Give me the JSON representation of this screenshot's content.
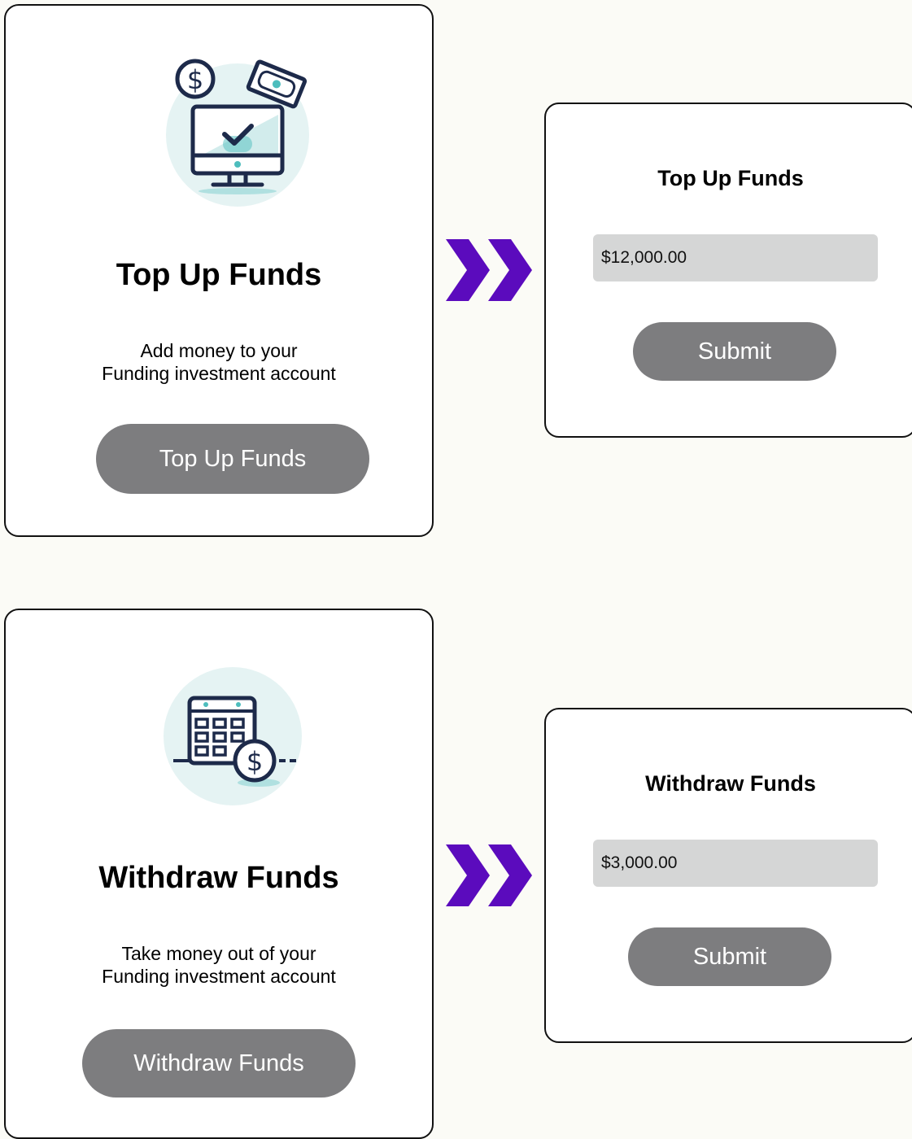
{
  "colors": {
    "page_background": "#fbfbf6",
    "card_background": "#ffffff",
    "button_gray": "#7d7d7f",
    "input_gray": "#d5d6d6",
    "chevron_purple": "#5b0bbd",
    "icon_navy": "#1d2a4a",
    "icon_teal": "#4dbdbd",
    "icon_bg": "#e5f3f3"
  },
  "top_up": {
    "card": {
      "icon": "computer-payment-icon",
      "title": "Top Up Funds",
      "description_line1": "Add money to your",
      "description_line2": "Funding investment account",
      "button_label": "Top Up Funds"
    },
    "arrow_icon": "double-chevron-right-icon",
    "form": {
      "title": "Top Up Funds",
      "amount_value": "$12,000.00",
      "submit_label": "Submit"
    }
  },
  "withdraw": {
    "card": {
      "icon": "calendar-dollar-icon",
      "title": "Withdraw Funds",
      "description_line1": "Take money out of your",
      "description_line2": "Funding investment account",
      "button_label": "Withdraw Funds"
    },
    "arrow_icon": "double-chevron-right-icon",
    "form": {
      "title": "Withdraw Funds",
      "amount_value": "$3,000.00",
      "submit_label": "Submit"
    }
  }
}
